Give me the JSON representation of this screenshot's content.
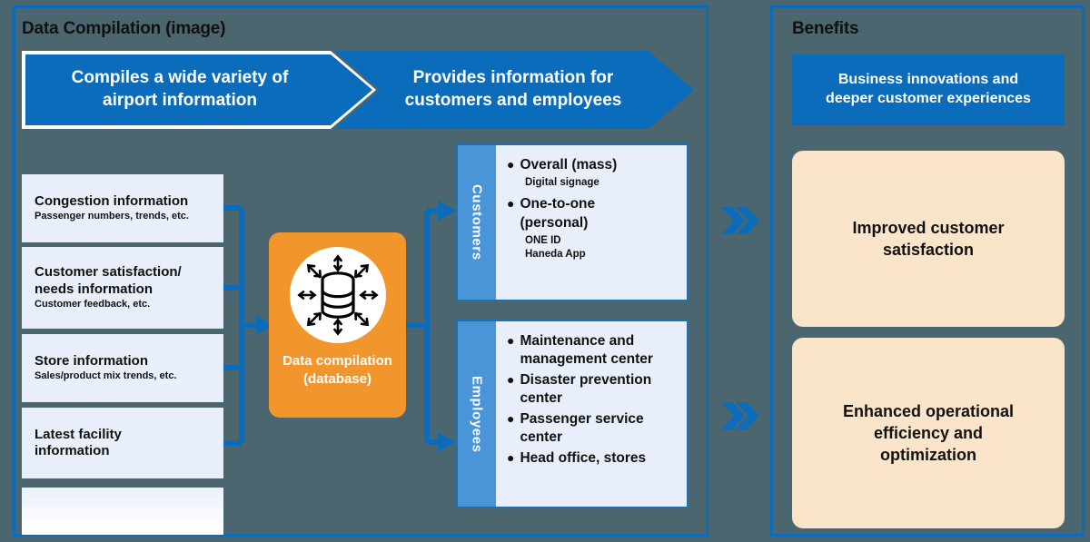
{
  "panels": {
    "left": {
      "title": "Data Compilation (image)"
    },
    "right": {
      "title": "Benefits"
    }
  },
  "banners": [
    {
      "label": "Compiles a wide variety of airport information",
      "line1": "Compiles a wide variety of",
      "line2": "airport information",
      "color": "#0a6cba"
    },
    {
      "label": "Provides information for customers and employees",
      "line1": "Provides information for",
      "line2": "customers and employees",
      "color": "#0a6cba"
    }
  ],
  "sources": [
    {
      "title": "Congestion information",
      "subtitle": "Passenger numbers, trends, etc."
    },
    {
      "title": "Customer satisfaction/ needs information",
      "title_line1": "Customer satisfaction/",
      "title_line2": "needs information",
      "subtitle": "Customer feedback, etc."
    },
    {
      "title": "Store information",
      "subtitle": "Sales/product mix trends, etc."
    },
    {
      "title": "Latest facility information",
      "title_line1": "Latest facility",
      "title_line2": "information",
      "subtitle": ""
    },
    {
      "title": "",
      "subtitle": ""
    }
  ],
  "hub": {
    "label_line1": "Data compilation",
    "label_line2": "(database)",
    "icon": "database-cylinder-icon",
    "color": "#f1962d"
  },
  "audiences": [
    {
      "tab_label": "Customers",
      "items": [
        {
          "main": "Overall (mass)",
          "sub": "Digital signage"
        },
        {
          "main": "One-to-one  (personal)",
          "main_line1": "One-to-one",
          "main_line2": " (personal)",
          "sub_line1": "ONE ID",
          "sub_line2": "Haneda App"
        }
      ]
    },
    {
      "tab_label": "Employees",
      "items": [
        {
          "main": "Maintenance and management center",
          "sub": ""
        },
        {
          "main": "Disaster prevention center",
          "sub": ""
        },
        {
          "main": "Passenger service center",
          "sub": ""
        },
        {
          "main": "Head office, stores",
          "sub": ""
        }
      ]
    }
  ],
  "benefits": {
    "header": {
      "line1": "Business innovations and",
      "line2": "deeper customer experiences",
      "color": "#0a6cba"
    },
    "cards": [
      {
        "line1": "Improved customer",
        "line2": "satisfaction",
        "line3": "",
        "color": "#fae5cb"
      },
      {
        "line1": "Enhanced operational",
        "line2": "efficiency and",
        "line3": "optimization",
        "color": "#fae5cb"
      }
    ]
  },
  "colors": {
    "background": "#4c6670",
    "primary_blue": "#0a6cba",
    "tab_blue": "#4a95d8",
    "box_blue": "#e9effa",
    "orange": "#f1962d",
    "peach": "#fae5cb"
  }
}
